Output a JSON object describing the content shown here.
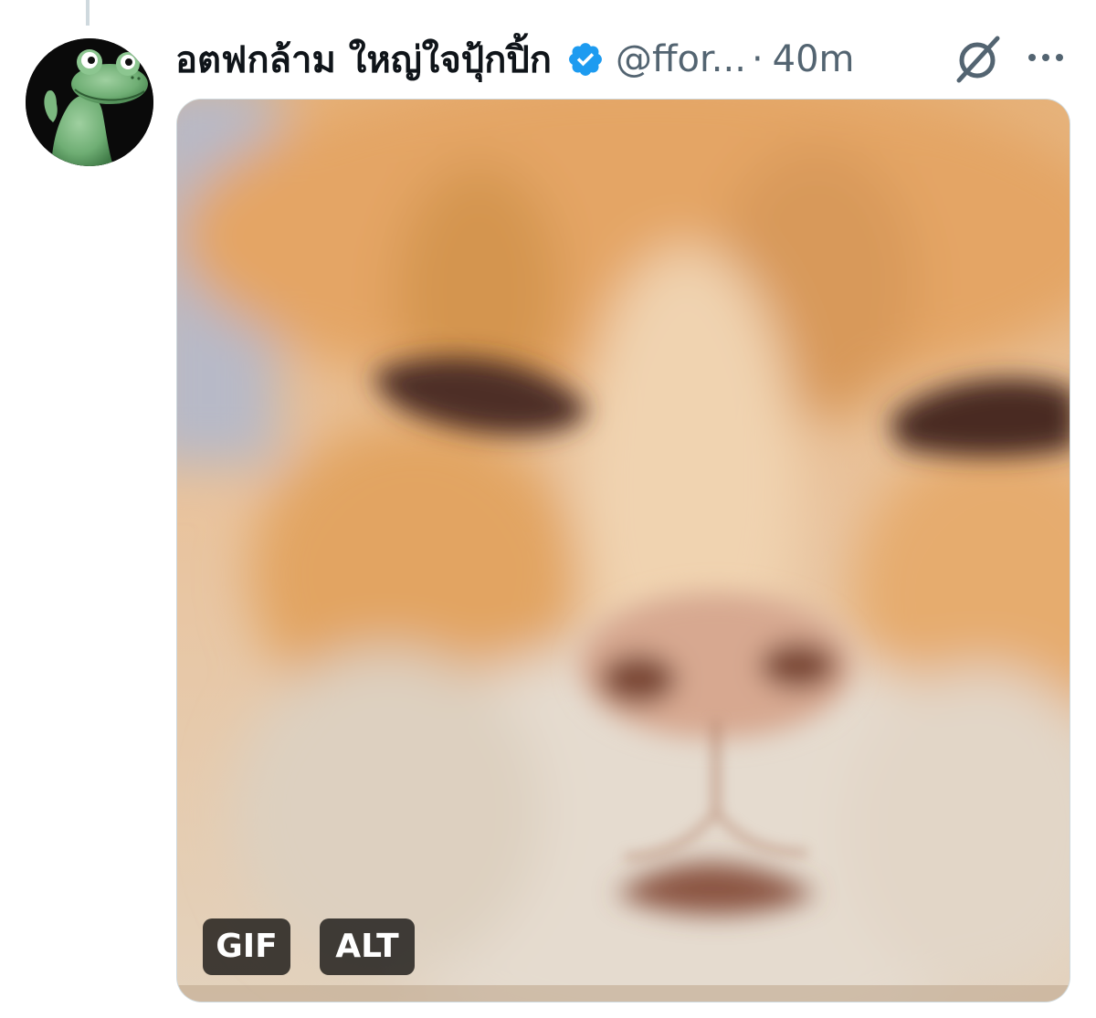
{
  "post": {
    "author": {
      "display_name": "อตฟกล้าม ใหญ่ใจปุ้กปิ้ก",
      "handle": "@ffor...",
      "verified": true,
      "verified_color": "#1d9bf0"
    },
    "separator": "·",
    "timestamp": "40m",
    "media": {
      "type": "gif",
      "gif_label": "GIF",
      "alt_label": "ALT"
    },
    "icons": {
      "avatar": "frog-avatar",
      "verified": "verified-badge-icon",
      "grok": "grok-icon",
      "more": "more-icon"
    }
  },
  "colors": {
    "text_primary": "#0f1419",
    "text_secondary": "#536471",
    "border": "#cfd9de"
  }
}
